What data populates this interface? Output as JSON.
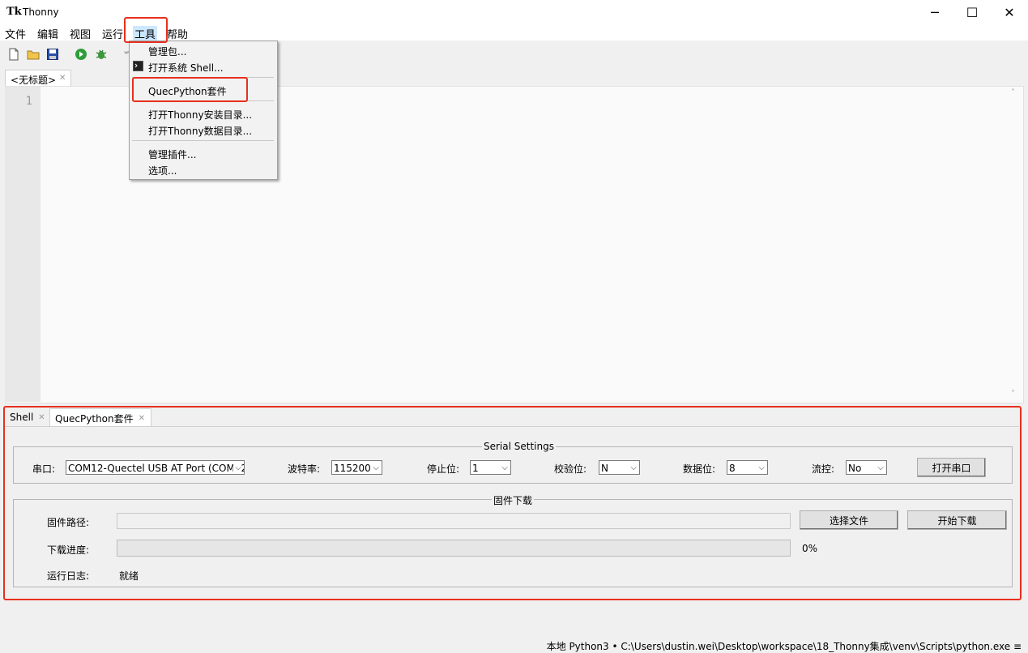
{
  "window": {
    "logo": "Tk",
    "title": "Thonny",
    "minimize": "─",
    "maximize": "☐",
    "close": "✕"
  },
  "menubar": [
    "文件",
    "编辑",
    "视图",
    "运行",
    "工具",
    "帮助"
  ],
  "toolbar": {
    "icons": [
      "new-file-icon",
      "open-file-icon",
      "save-icon",
      "run-icon",
      "debug-icon",
      "undo-icon"
    ]
  },
  "editor": {
    "tab_label": "<无标题>",
    "line_number": "1"
  },
  "tools_menu": {
    "items": [
      "管理包...",
      "打开系统 Shell...",
      "QuecPython套件",
      "打开Thonny安装目录...",
      "打开Thonny数据目录...",
      "管理插件...",
      "选项..."
    ]
  },
  "bottom_tabs": [
    "Shell",
    "QuecPython套件"
  ],
  "serial": {
    "title": "Serial Settings",
    "port_label": "串口:",
    "port_value": "COM12-Quectel USB AT Port (COM12)",
    "baud_label": "波特率:",
    "baud_value": "115200",
    "stop_label": "停止位:",
    "stop_value": "1",
    "parity_label": "校验位:",
    "parity_value": "N",
    "data_label": "数据位:",
    "data_value": "8",
    "flow_label": "流控:",
    "flow_value": "No",
    "open_button": "打开串口"
  },
  "firmware": {
    "title": "固件下载",
    "path_label": "固件路径:",
    "path_value": "",
    "choose_button": "选择文件",
    "start_button": "开始下载",
    "progress_label": "下载进度:",
    "progress_value": 0,
    "progress_text": "0%",
    "log_label": "运行日志:",
    "log_value": "就绪"
  },
  "statusbar": {
    "text": "本地 Python3 • C:\\Users\\dustin.wei\\Desktop\\workspace\\18_Thonny集成\\venv\\Scripts\\python.exe ≡"
  }
}
